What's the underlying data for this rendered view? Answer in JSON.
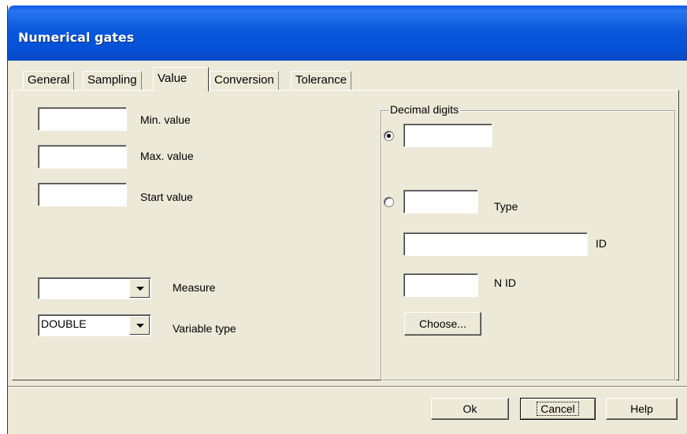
{
  "window": {
    "title": "Numerical gates"
  },
  "tabs": [
    {
      "label": "General"
    },
    {
      "label": "Sampling"
    },
    {
      "label": "Value",
      "active": true
    },
    {
      "label": "Conversion"
    },
    {
      "label": "Tolerance"
    }
  ],
  "value_tab": {
    "min_value": {
      "label": "Min. value",
      "value": ""
    },
    "max_value": {
      "label": "Max. value",
      "value": ""
    },
    "start_value": {
      "label": "Start value",
      "value": ""
    },
    "measure": {
      "label": "Measure",
      "selected": ""
    },
    "variable_type": {
      "label": "Variable type",
      "selected": "DOUBLE"
    }
  },
  "decimal_digits": {
    "title": "Decimal digits",
    "fixed_option": {
      "selected": true,
      "value": ""
    },
    "type_option": {
      "selected": false,
      "value": "",
      "label": "Type"
    },
    "id": {
      "label": "ID",
      "value": ""
    },
    "n_id": {
      "label": "N ID",
      "value": ""
    },
    "choose_button": "Choose..."
  },
  "buttons": {
    "ok": "Ok",
    "cancel": "Cancel",
    "help": "Help"
  },
  "colors": {
    "titlebar": "#0a58dc",
    "dialog_bg": "#ece9d8",
    "title_text": "#ffffff"
  }
}
